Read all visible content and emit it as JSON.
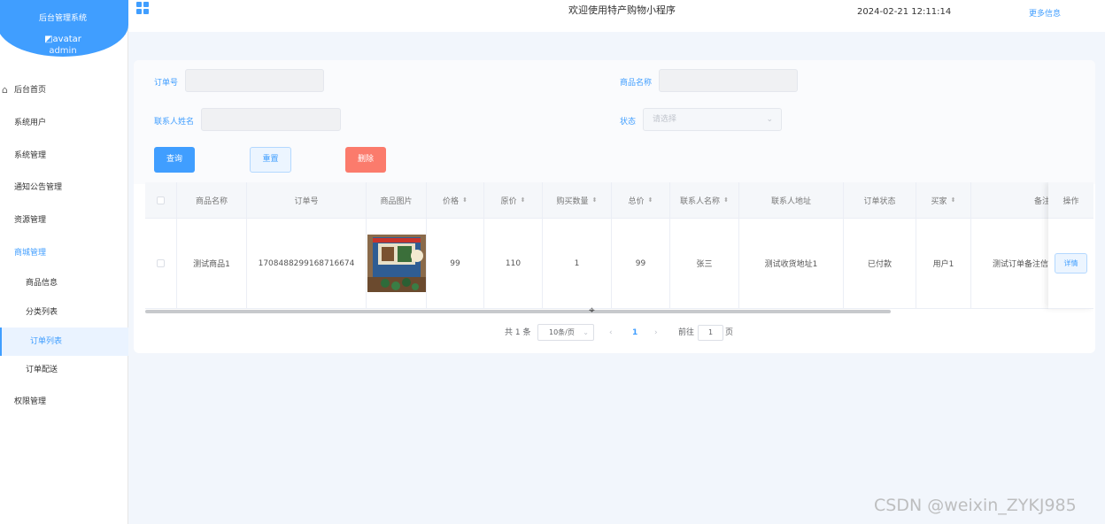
{
  "sidebar": {
    "system_title": "后台管理系统",
    "avatar_alt": "avatar",
    "username": "admin",
    "items": [
      {
        "label": "后台首页",
        "icon": "home-icon"
      },
      {
        "label": "系统用户"
      },
      {
        "label": "系统管理"
      },
      {
        "label": "通知公告管理"
      },
      {
        "label": "资源管理"
      },
      {
        "label": "商城管理"
      },
      {
        "label": "商品信息"
      },
      {
        "label": "分类列表"
      },
      {
        "label": "订单列表"
      },
      {
        "label": "订单配送"
      },
      {
        "label": "权限管理"
      }
    ]
  },
  "header": {
    "menu_icon": "grid-icon",
    "title": "欢迎使用特产购物小程序",
    "datetime": "2024-02-21 12:11:14",
    "more": "更多信息"
  },
  "search": {
    "order_no_label": "订单号",
    "goods_name_label": "商品名称",
    "contact_name_label": "联系人姓名",
    "status_label": "状态",
    "status_placeholder": "请选择",
    "query_btn": "查询",
    "reset_btn": "重置",
    "delete_btn": "删除"
  },
  "table": {
    "columns": [
      "商品名称",
      "订单号",
      "商品图片",
      "价格",
      "原价",
      "购买数量",
      "总价",
      "联系人名称",
      "联系人地址",
      "订单状态",
      "买家",
      "备注",
      "操作"
    ],
    "rows": [
      {
        "goods_name": "测试商品1",
        "order_no": "1708488299168716674",
        "price": "99",
        "original_price": "110",
        "quantity": "1",
        "total": "99",
        "contact_name": "张三",
        "contact_address": "测试收货地址1",
        "status": "已付款",
        "buyer": "用户1",
        "remark": "测试订单备注信息",
        "action": "详情"
      }
    ]
  },
  "pagination": {
    "total": "共 1 条",
    "page_size": "10条/页",
    "prev": "‹",
    "current": "1",
    "next": "›",
    "goto_label": "前往",
    "goto_value": "1",
    "page_unit": "页"
  },
  "watermark": "CSDN @weixin_ZYKJ985",
  "colors": {
    "primary": "#409eff",
    "danger": "#fb7b6c",
    "background": "#f2f6fc"
  }
}
